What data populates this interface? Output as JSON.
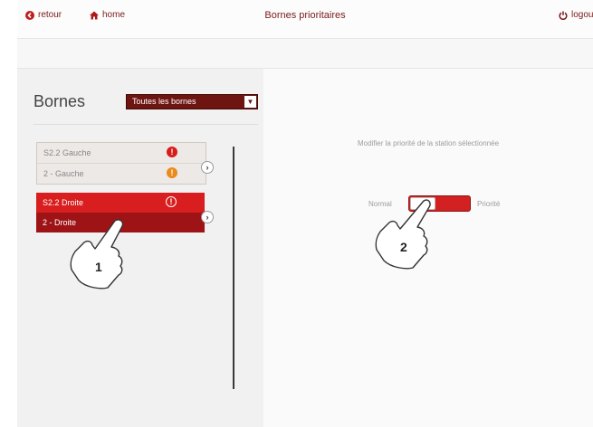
{
  "topbar": {
    "back_label": "retour",
    "home_label": "home",
    "title": "Bornes prioritaires",
    "logout_label": "logou"
  },
  "left": {
    "heading": "Bornes",
    "filter_selected": "Toutes les bornes",
    "stations": [
      {
        "rows": [
          "S2.2 Gauche",
          "2 - Gauche"
        ],
        "alerts": [
          "red",
          "orange"
        ],
        "selected": false
      },
      {
        "rows": [
          "S2.2 Droite",
          "2 - Droite"
        ],
        "alerts": [
          "outline"
        ],
        "selected": true
      }
    ]
  },
  "right": {
    "instruction": "Modifier la priorité de la station sélectionnée",
    "toggle_left_label": "Normal",
    "toggle_right_label": "Priorité"
  },
  "annotations": {
    "hand1": "1",
    "hand2": "2"
  },
  "colors": {
    "brand_dark": "#6e1512",
    "selected_red": "#d81e1e",
    "toggle_red": "#d32020",
    "alert_orange": "#eb8a1c"
  },
  "icons": [
    "back-circle-icon",
    "home-icon",
    "power-icon",
    "alert-icon",
    "chevron-right-icon",
    "hand-pointer-icon"
  ]
}
